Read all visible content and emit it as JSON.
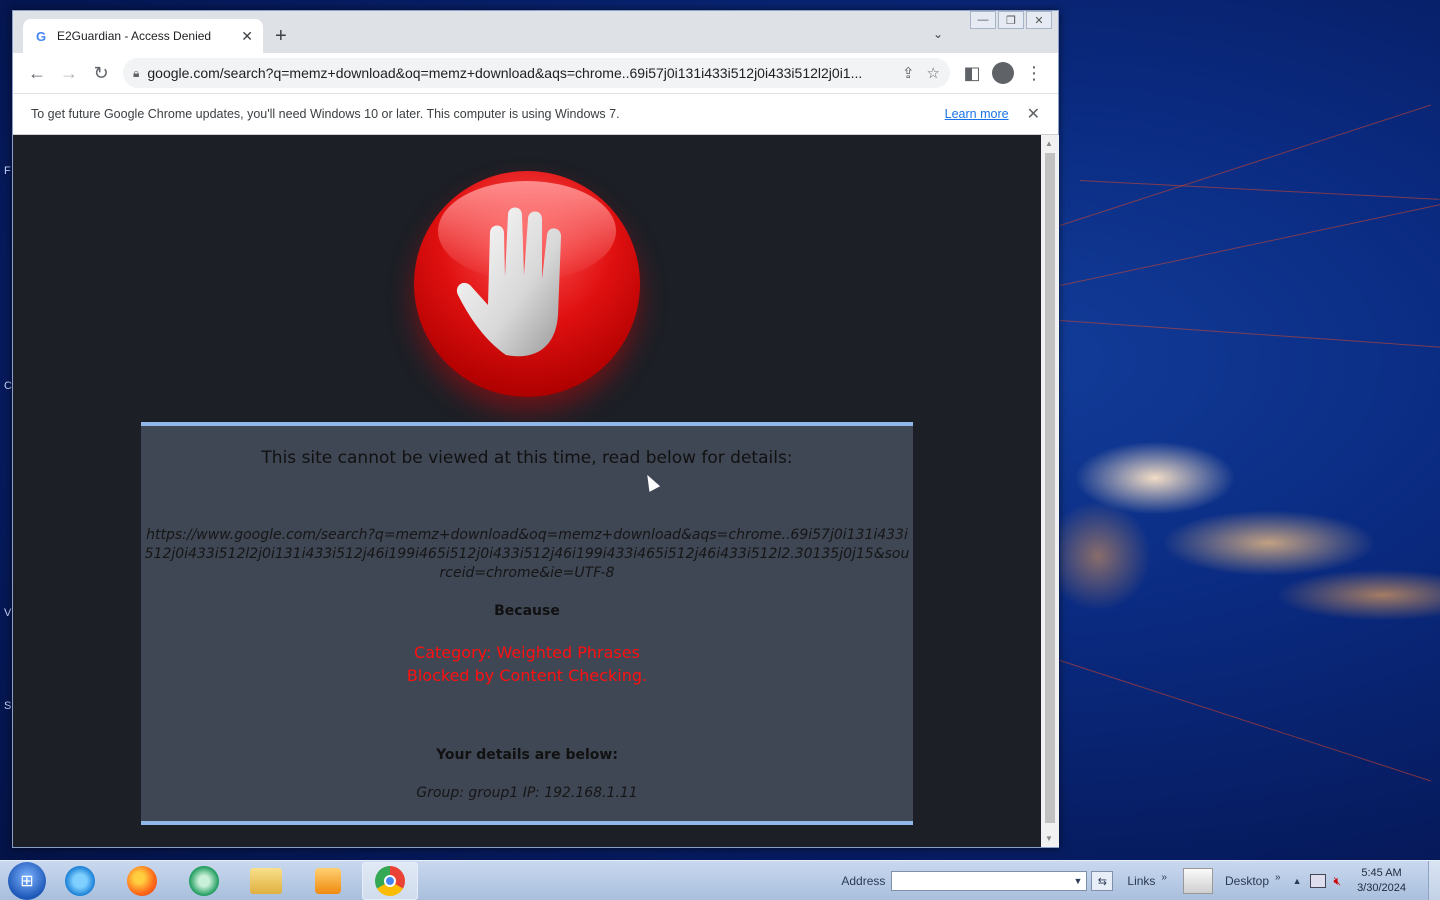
{
  "desktop": {
    "edge_letters": [
      "F",
      "C",
      "V",
      "S"
    ]
  },
  "browser": {
    "tab": {
      "favicon": "G",
      "title": "E2Guardian - Access Denied",
      "close": "✕"
    },
    "new_tab": "+",
    "tab_search": "⌄",
    "window_controls": {
      "minimize": "—",
      "maximize": "❐",
      "close": "✕"
    },
    "toolbar": {
      "back": "←",
      "forward": "→",
      "reload": "↻",
      "url": "google.com/search?q=memz+download&oq=memz+download&aqs=chrome..69i57j0i131i433i512j0i433i512l2j0i1...",
      "share": "⇪",
      "bookmark": "☆",
      "sidebar": "◧",
      "menu": "⋮"
    },
    "infobar": {
      "message": "To get future Google Chrome updates, you'll need Windows 10 or later. This computer is using Windows 7.",
      "learn_more": "Learn more",
      "close": "✕"
    }
  },
  "page": {
    "heading": "This site cannot be viewed at this time, read below for details:",
    "blocked_url": "https://www.google.com/search?q=memz+download&oq=memz+download&aqs=chrome..69i57j0i131i433i512j0i433i512l2j0i131i433i512j46i199i465i512j0i433i512j46i199i433i465i512j46i433i512l2.30135j0j15&sourceid=chrome&ie=UTF-8",
    "because_label": "Because",
    "reason_line1": "Category: Weighted Phrases",
    "reason_line2": "Blocked by Content Checking.",
    "details_title": "Your details are below:",
    "details": "Group: group1   IP: 192.168.1.11"
  },
  "taskbar": {
    "start_icon": "windows-orb",
    "apps": [
      "internet-explorer",
      "firefox",
      "teamviewer",
      "file-explorer",
      "media-player",
      "chrome"
    ],
    "address_label": "Address",
    "links_label": "Links",
    "desktop_label": "Desktop",
    "time": "5:45 AM",
    "date": "3/30/2024"
  }
}
